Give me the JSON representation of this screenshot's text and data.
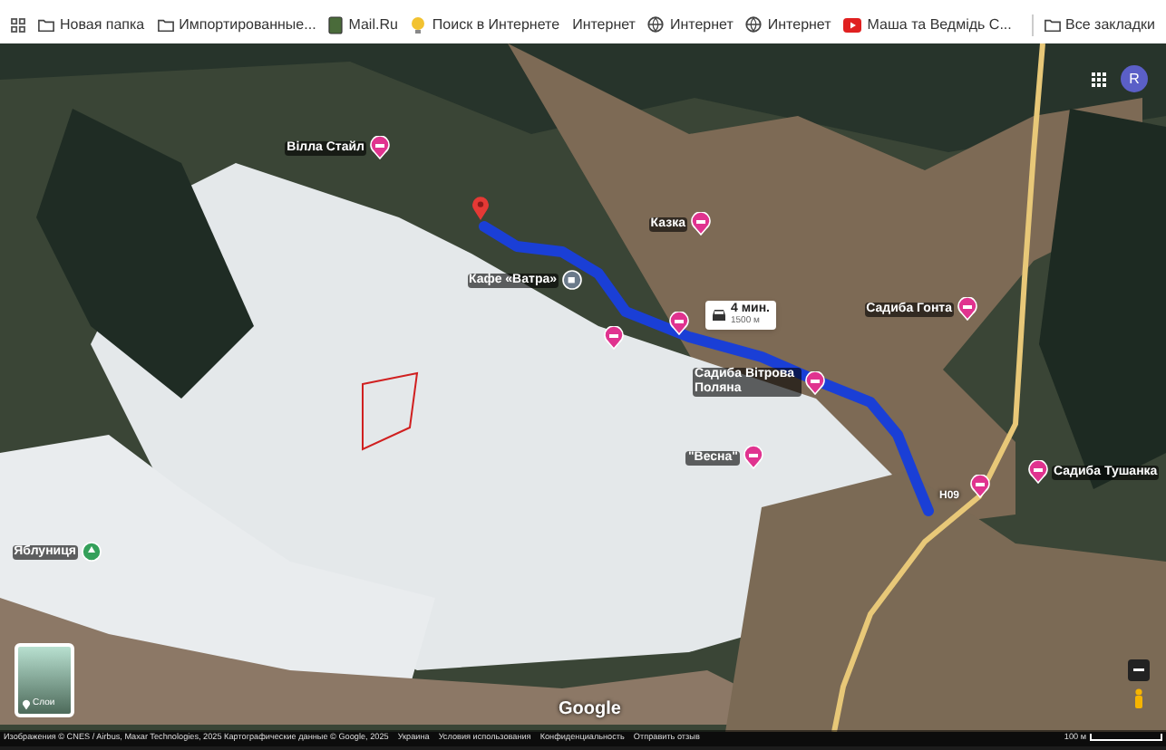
{
  "bookmarks_bar": {
    "items": [
      {
        "label": "Новая папка",
        "kind": "folder"
      },
      {
        "label": "Импортированные...",
        "kind": "folder"
      },
      {
        "label": "Mail.Ru",
        "kind": "mail"
      },
      {
        "label": "Поиск в Интернете",
        "kind": "search"
      },
      {
        "label": "Интернет",
        "kind": "plain"
      },
      {
        "label": "Интернет",
        "kind": "globe"
      },
      {
        "label": "Интернет",
        "kind": "globe"
      },
      {
        "label": "Маша та Ведмідь С...",
        "kind": "video"
      }
    ],
    "all_bookmarks": "Все закладки"
  },
  "account": {
    "initial": "R"
  },
  "map": {
    "places": [
      {
        "name": "Вілла Стайл",
        "kind": "lodging"
      },
      {
        "name": "Казка",
        "kind": "lodging"
      },
      {
        "name": "Кафе «Ватра»",
        "kind": "cafe"
      },
      {
        "name": "Садиба Вітрова Поляна",
        "kind": "lodging"
      },
      {
        "name": "\"Весна\"",
        "kind": "lodging"
      },
      {
        "name": "Садиба Гонта",
        "kind": "lodging"
      },
      {
        "name": "Садиба Тушанка",
        "kind": "lodging"
      },
      {
        "name": "Яблуниця",
        "kind": "park"
      }
    ],
    "route": {
      "duration": "4 мин.",
      "distance": "1500 м"
    },
    "road_label": "Н09",
    "layers_button": {
      "label": "Слои"
    },
    "logo": "Google",
    "attribution": "Изображения © CNES / Airbus, Maxar Technologies, 2025 Картографические данные © Google, 2025",
    "footer_links": [
      "Украина",
      "Условия использования",
      "Конфиденциальность",
      "Отправить отзыв"
    ],
    "scale": "100 м"
  }
}
